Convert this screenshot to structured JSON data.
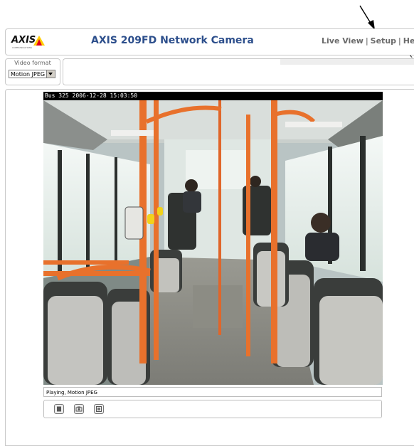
{
  "header": {
    "logo_text": "AXIS",
    "logo_subtext": "COMMUNICATIONS",
    "title": "AXIS 209FD Network Camera",
    "nav": [
      {
        "label": "Live View"
      },
      {
        "label": "Setup"
      },
      {
        "label": "Help"
      }
    ],
    "separator": "|"
  },
  "video_format": {
    "label": "Video format",
    "selected": "Motion JPEG"
  },
  "video": {
    "overlay_text": "Bus 325 2006-12-28 15:03:50"
  },
  "status": {
    "text": "Playing, Motion JPEG"
  },
  "controls": [
    {
      "icon": "stop-icon"
    },
    {
      "icon": "snapshot-icon"
    },
    {
      "icon": "view-full-screen-icon"
    }
  ],
  "colors": {
    "title": "#2d4f8c",
    "logo_yellow": "#ffcc00",
    "logo_red": "#e2001a"
  }
}
